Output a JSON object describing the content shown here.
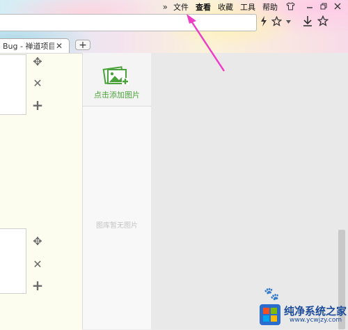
{
  "menubar": {
    "overflow": "»",
    "items": [
      "文件",
      "查看",
      "收藏",
      "工具",
      "帮助"
    ],
    "active": "查看"
  },
  "tab": {
    "title": "Bug - 禅道项目",
    "close": "✕",
    "new": "+"
  },
  "toolbar": {
    "icons": [
      "lightning-icon",
      "star-icon",
      "caret-down-icon",
      "download-icon",
      "favorites-star-icon"
    ]
  },
  "editor": {
    "move_symbol": "✥",
    "delete_symbol": "✕",
    "add_symbol": "+"
  },
  "image_panel": {
    "add_label": "点击添加图片",
    "empty_label": "图库暂无图片"
  },
  "watermark": {
    "title": "纯净系统之家",
    "url": "www.ycwjzy.com"
  },
  "colors": {
    "accent_green": "#4aa33a",
    "annotation_pink": "#f03cc4",
    "underline_red": "#e0144a"
  }
}
